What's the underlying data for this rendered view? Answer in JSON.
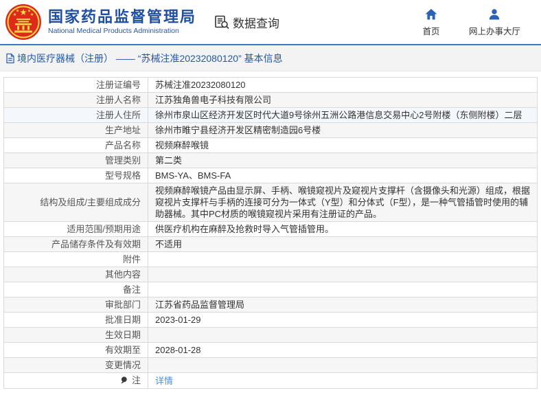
{
  "header": {
    "org_name_zh": "国家药品监督管理局",
    "org_name_en": "National Medical Products Administration",
    "query_title": "数据查询",
    "nav": [
      {
        "label": "首页"
      },
      {
        "label": "网上办事大厅"
      }
    ]
  },
  "breadcrumb": {
    "text": "境内医疗器械（注册） —— “苏械注准20232080120” 基本信息"
  },
  "table": {
    "rows": [
      {
        "label": "注册证编号",
        "value": "苏械注准20232080120"
      },
      {
        "label": "注册人名称",
        "value": "江苏独角兽电子科技有限公司"
      },
      {
        "label": "注册人住所",
        "value": "徐州市泉山区经济开发区时代大道9号徐州五洲公路港信息交易中心2号附楼（东侧附楼）二层"
      },
      {
        "label": "生产地址",
        "value": "徐州市睢宁县经济开发区精密制造园6号楼"
      },
      {
        "label": "产品名称",
        "value": "视频麻醉喉镜"
      },
      {
        "label": "管理类别",
        "value": "第二类"
      },
      {
        "label": "型号规格",
        "value": "BMS-YA、BMS-FA"
      },
      {
        "label": "结构及组成/主要组成成分",
        "value": "视频麻醉喉镜产品由显示屏、手柄、喉镜窥视片及窥视片支撑杆（含摄像头和光源）组成，根据窥视片支撑杆与手柄的连接可分为一体式（Y型）和分体式（F型），是一种气管插管时使用的辅助器械。其中PC材质的喉镜窥视片采用有注册证的产品。"
      },
      {
        "label": "适用范围/预期用途",
        "value": "供医疗机构在麻醉及抢救时导入气管插管用。"
      },
      {
        "label": "产品储存条件及有效期",
        "value": "不适用"
      },
      {
        "label": "附件",
        "value": ""
      },
      {
        "label": "其他内容",
        "value": ""
      },
      {
        "label": "备注",
        "value": ""
      },
      {
        "label": "审批部门",
        "value": "江苏省药品监督管理局"
      },
      {
        "label": "批准日期",
        "value": "2023-01-29"
      },
      {
        "label": "生效日期",
        "value": ""
      },
      {
        "label": "有效期至",
        "value": "2028-01-28"
      },
      {
        "label": "变更情况",
        "value": ""
      },
      {
        "label": "注",
        "value": "详情",
        "link": true,
        "icon": "note-pin-icon"
      }
    ]
  },
  "colors": {
    "brand_blue": "#1f4fa0",
    "icon_blue": "#2a63b5",
    "accent_line": "#4272c8",
    "link_blue": "#4a90d9",
    "emblem_red": "#de2a1b",
    "emblem_gold": "#f7d849",
    "alt_row": "#f6f6f6",
    "hover_row": "#f4f7fb"
  }
}
